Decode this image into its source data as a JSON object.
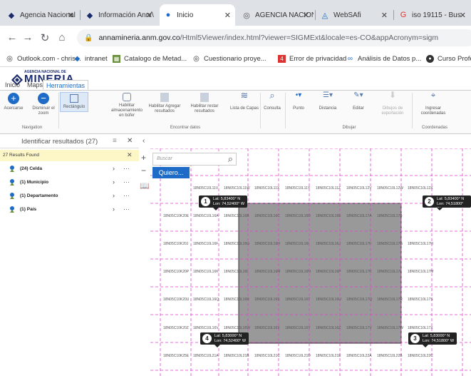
{
  "browser": {
    "tabs": [
      {
        "title": "Agencia Nacional",
        "icon": "anm-diamond-icon"
      },
      {
        "title": "Información Ann/\\",
        "icon": "anm-diamond-icon"
      },
      {
        "title": "Inicio",
        "icon": "anm-people-icon"
      },
      {
        "title": "AGENCIA NACION",
        "icon": "globe-icon"
      },
      {
        "title": "WebSAfi",
        "icon": "websafi-icon"
      },
      {
        "title": "iso 19115 - Bus",
        "icon": "google-icon"
      }
    ],
    "active_tab_index": 2,
    "url_host": "annamineria.anm.gov.co",
    "url_path": "/Html5Viewer/index.html?viewer=SIGMExt&locale=es-CO&appAcronym=sigm",
    "bookmarks": [
      "Outlook.com - chris...",
      "intranet",
      "Catalogo de Metad...",
      "Cuestionario proye...",
      "Error de privacidad",
      "Análisis de Datos p...",
      "Curso Profesio"
    ]
  },
  "app": {
    "logo_top": "AGENCIA NACIONAL DE",
    "logo_main": "MINERIA",
    "ribbon_tabs": [
      "Inicio",
      "Maps",
      "Herramientas"
    ],
    "active_ribbon_tab": "Herramientas",
    "ribbon_buttons": [
      "Acercarse",
      "Disminuir el zoom",
      "Rectángulo",
      "Habilitar almacenamiento en búfer",
      "Habilitar Agregar resultados",
      "Habilitar restar resultados",
      "Lista de Capas",
      "Consulta",
      "Punto",
      "Distancia",
      "Editar",
      "Dibujos de exportación",
      "Ingresar coordenadas"
    ],
    "ribbon_groups": [
      "Navigation",
      "Encontrar datos",
      "Dibujar",
      "Coordenadas"
    ]
  },
  "results_panel": {
    "title": "Identificar resultados (27)",
    "found": "27 Results Found",
    "items": [
      "(24) Celda",
      "(1) Municipio",
      "(1) Departamento",
      "(1) País"
    ]
  },
  "map": {
    "search_placeholder": "Buscar",
    "search_button": "Quiero...",
    "callouts": [
      {
        "n": "1",
        "lat": "Lat: 5,83400° N",
        "lon": "Lon: 74,52400° W"
      },
      {
        "n": "2",
        "lat": "Lat: 5,83400° N",
        "lon": "Lon: 74,51800° W"
      },
      {
        "n": "3",
        "lat": "Lat: 5,83000° N",
        "lon": "Lon: 74,51800° W"
      },
      {
        "n": "4",
        "lat": "Lat: 5,83000° N",
        "lon": "Lon: 74,52400° W"
      }
    ],
    "cell_rows": [
      [
        "18N05C10L11V",
        "18N05C10L11W",
        "18N05C10L11X",
        "18N05C10L11Y",
        "18N05C10L11Z",
        "18N05C10L12V",
        "18N05C10L12W",
        "18N05C10L12X"
      ],
      [
        "18N05C10K20E",
        "18N05C10L16A",
        "18N05C10L16B",
        "18N05C10L16C",
        "18N05C10L16D",
        "18N05C10L16E",
        "18N05C10L17A",
        "18N05C10L17B"
      ],
      [
        "18N05C10K20J",
        "18N05C10L16F",
        "18N05C10L16G",
        "18N05C10L16H",
        "18N05C10L16I",
        "18N05C10L16J",
        "18N05C10L17F",
        "18N05C10L17G",
        "18N05C10L17H"
      ],
      [
        "18N05C10K20P",
        "18N05C10L16K",
        "18N05C10L16L",
        "18N05C10L16M",
        "18N05C10L16N",
        "18N05C10L16P",
        "18N05C10L17K",
        "18N05C10L17L",
        "18N05C10L17M"
      ],
      [
        "18N05C10K20U",
        "18N05C10L16Q",
        "18N05C10L16R",
        "18N05C10L16S",
        "18N05C10L16T",
        "18N05C10L16U",
        "18N05C10L17Q",
        "18N05C10L17R",
        "18N05C10L17S"
      ],
      [
        "18N05C10K20Z",
        "18N05C10L16V",
        "18N05C10L16W",
        "18N05C10L16X",
        "18N05C10L16Y",
        "18N05C10L16Z",
        "18N05C10L17V",
        "18N05C10L17W",
        "18N05C10L17X"
      ],
      [
        "18N05C10K25E",
        "18N05C10L21A",
        "18N05C10L21B",
        "18N05C10L21C",
        "18N05C10L21D",
        "18N05C10L21E",
        "18N05C10L22A",
        "18N05C10L22B",
        "18N05C10L22C"
      ]
    ]
  },
  "colors": {
    "accent": "#1e6cc7",
    "selection": "#999999",
    "grid": "#e040d0",
    "result_bar": "#fdf7c8"
  }
}
